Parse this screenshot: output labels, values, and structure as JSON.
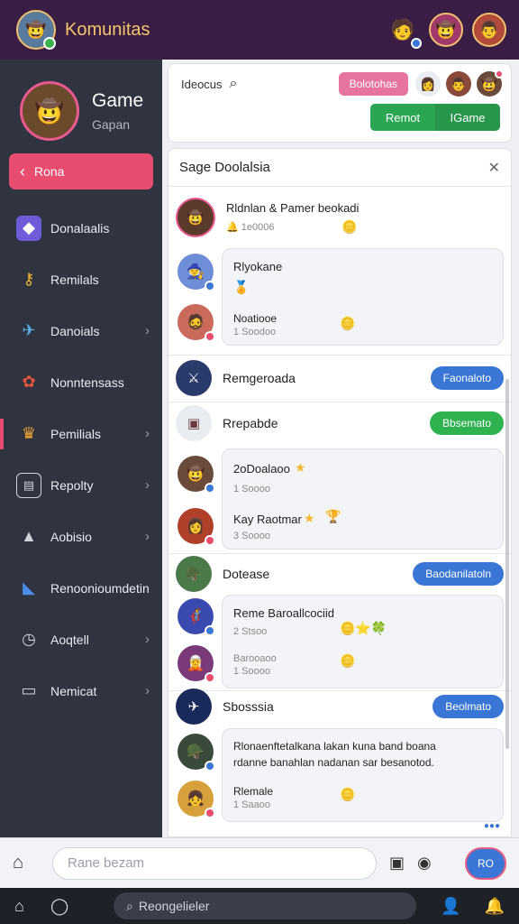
{
  "app": {
    "title": "Komunitas"
  },
  "colors": {
    "accent": "#e84d6f",
    "blue": "#3a76d6",
    "green": "#2fb351",
    "topbar": "#3a1d45"
  },
  "sidebar": {
    "profile": {
      "name": "Game",
      "subtitle": "Gapan"
    },
    "back_label": "Rona",
    "items": [
      {
        "label": "Donalaalis",
        "icon": "cube-icon",
        "arrow": false
      },
      {
        "label": "Remilals",
        "icon": "key-icon",
        "arrow": false
      },
      {
        "label": "Danoials",
        "icon": "plane-icon",
        "arrow": true
      },
      {
        "label": "Nonntensass",
        "icon": "gift-icon",
        "arrow": false
      },
      {
        "label": "Pemilials",
        "icon": "crown-icon",
        "arrow": true
      },
      {
        "label": "Repolty",
        "icon": "card-icon",
        "arrow": true
      },
      {
        "label": "Aobisio",
        "icon": "bird-icon",
        "arrow": true
      },
      {
        "label": "Renoonioumdetin",
        "icon": "shield-icon",
        "arrow": false
      },
      {
        "label": "Aoqtell",
        "icon": "clock-icon",
        "arrow": true
      },
      {
        "label": "Nemicat",
        "icon": "briefcase-icon",
        "arrow": true
      }
    ]
  },
  "topcard": {
    "label": "Ideocus",
    "pink_label": "Bolotohas",
    "seg_left": "Remot",
    "seg_right": "IGame"
  },
  "panel": {
    "title": "Sage Doolalsia",
    "groups": [
      {
        "name": "Rldnlan & Pamer beokadi",
        "sub": "1e0006",
        "button": null
      },
      {
        "name": "Remgeroada",
        "button": "Faonaloto",
        "color": "blue"
      },
      {
        "name": "Rrepabde",
        "button": "Bbsemato",
        "color": "green"
      },
      {
        "name": "Dotease",
        "button": "Baodanilatoln",
        "color": "blue"
      },
      {
        "name": "Sbosssia",
        "button": "Beolmato",
        "color": "blue"
      }
    ],
    "bubble1": {
      "title": "Rlyokane",
      "sub_title": "Noatiooe",
      "sub_count": "1 Soodoo"
    },
    "bubble2": {
      "title": "2oDoalaoo",
      "count": "1 Soooo",
      "line2": "Kay Raotmar",
      "count2": "3 Soooo"
    },
    "bubble3": {
      "title": "Reme Baroallcociid",
      "count": "2 Stsoo",
      "line2": "Barooaoo",
      "count2": "1 Soooo"
    },
    "bubble4": {
      "line1": "Rlonaenftetalkana lakan kuna band boana",
      "line2": "rdanne banahlan nadanan sar besanotod.",
      "title2": "Rlemale",
      "count2": "1 Saaoo"
    },
    "typing": "●●●"
  },
  "composer": {
    "placeholder": "Rane bezam",
    "send_label": "RO"
  },
  "bottomnav": {
    "search_placeholder": "Reongelieler"
  }
}
